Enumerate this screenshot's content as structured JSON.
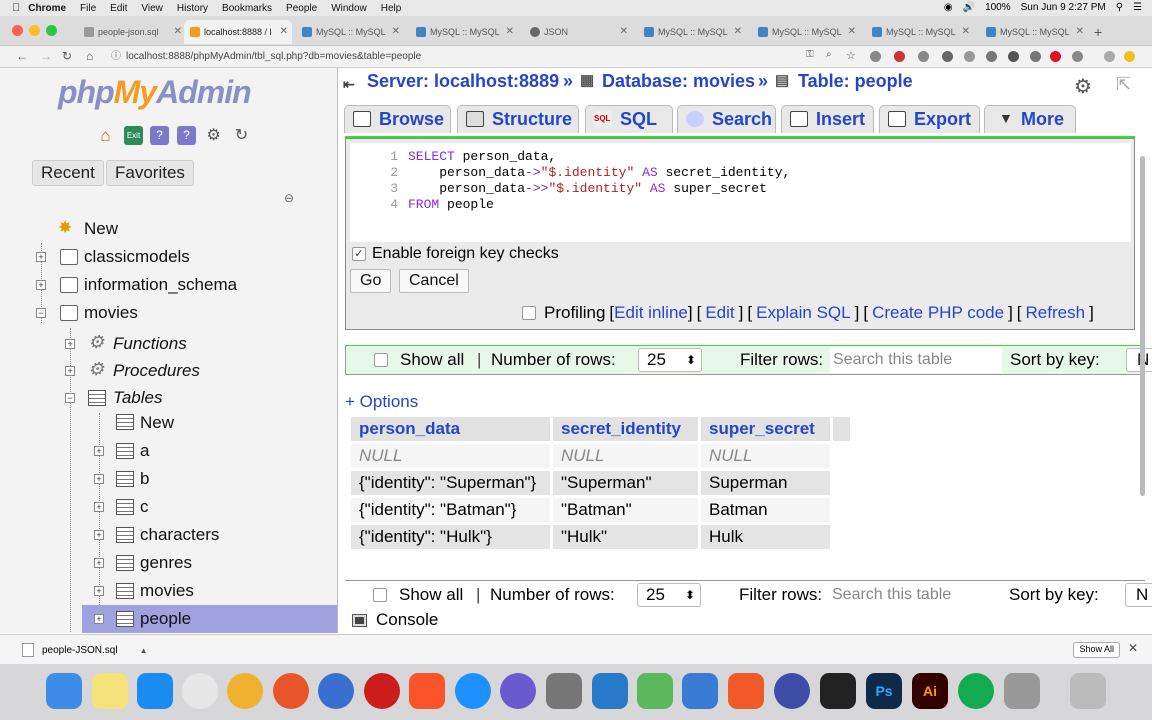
{
  "menubar": {
    "app": "Chrome",
    "items": [
      "File",
      "Edit",
      "View",
      "History",
      "Bookmarks",
      "People",
      "Window",
      "Help"
    ],
    "battery": "100%",
    "clock": "Sun Jun 9  2:27 PM"
  },
  "browser": {
    "tabs": [
      {
        "label": "people-json.sql",
        "active": false
      },
      {
        "label": "localhost:8888 / l",
        "active": true
      },
      {
        "label": "MySQL :: MySQL",
        "active": false
      },
      {
        "label": "MySQL :: MySQL",
        "active": false
      },
      {
        "label": "JSON",
        "active": false
      },
      {
        "label": "MySQL :: MySQL",
        "active": false
      },
      {
        "label": "MySQL :: MySQL",
        "active": false
      },
      {
        "label": "MySQL :: MySQL",
        "active": false
      },
      {
        "label": "MySQL :: MySQL",
        "active": false
      }
    ],
    "url": "localhost:8888/phpMyAdmin/tbl_sql.php?db=movies&table=people"
  },
  "sidebar": {
    "logo_php": "php",
    "logo_my": "My",
    "logo_admin": "Admin",
    "recent_label": "Recent",
    "favorites_label": "Favorites",
    "tree": {
      "new": "New",
      "db1": "classicmodels",
      "db2": "information_schema",
      "db3": "movies",
      "functions": "Functions",
      "procedures": "Procedures",
      "tables": "Tables",
      "table_new": "New",
      "t_a": "a",
      "t_b": "b",
      "t_c": "c",
      "t_characters": "characters",
      "t_genres": "genres",
      "t_movies": "movies",
      "t_people": "people"
    }
  },
  "breadcrumb": {
    "server": "Server: localhost:8889",
    "database": "Database: movies",
    "table": "Table: people",
    "sep": "»"
  },
  "tabs": {
    "browse": "Browse",
    "structure": "Structure",
    "sql": "SQL",
    "search": "Search",
    "insert": "Insert",
    "export": "Export",
    "more": "More"
  },
  "sql": {
    "line_numbers": [
      "1",
      "2",
      "3",
      "4"
    ],
    "line1_kw": "SELECT",
    "line1_rest": " person_data,",
    "line2_a": "    person_data",
    "line2_op": "->",
    "line2_str": "\"$.identity\"",
    "line2_as": " AS",
    "line2_rest": " secret_identity,",
    "line3_a": "    person_data",
    "line3_op": "->>",
    "line3_str": "\"$.identity\"",
    "line3_as": " AS",
    "line3_rest": " super_secret",
    "line4_kw": "FROM",
    "line4_rest": " people",
    "fk_label": "Enable foreign key checks",
    "go": "Go",
    "cancel": "Cancel",
    "profiling": "Profiling",
    "links": [
      "[",
      "Edit inline",
      "]",
      "[",
      "Edit",
      "]",
      "[",
      "Explain SQL",
      "]",
      "[",
      "Create PHP code",
      "]",
      "[",
      "Refresh",
      "]"
    ]
  },
  "navbar": {
    "show_all": "Show all",
    "sep": "|",
    "rows_label": "Number of rows:",
    "rows_value": "25",
    "filter_label": "Filter rows:",
    "filter_placeholder": "Search this table",
    "sort_label": "Sort by key:",
    "sort_value": "N"
  },
  "options_label": "+ Options",
  "results": {
    "columns": [
      "person_data",
      "secret_identity",
      "super_secret"
    ],
    "rows": [
      [
        "NULL",
        "NULL",
        "NULL"
      ],
      [
        "{\"identity\": \"Superman\"}",
        "\"Superman\"",
        "Superman"
      ],
      [
        "{\"identity\": \"Batman\"}",
        "\"Batman\"",
        "Batman"
      ],
      [
        "{\"identity\": \"Hulk\"}",
        "\"Hulk\"",
        "Hulk"
      ]
    ]
  },
  "console_label": "Console",
  "downloads": {
    "file": "people-JSON.sql",
    "show_all": "Show All"
  },
  "dock": {
    "ps": "Ps",
    "ai": "Ai"
  }
}
